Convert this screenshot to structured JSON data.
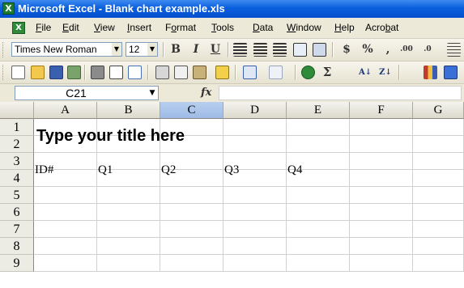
{
  "window": {
    "title": "Microsoft Excel - Blank chart example.xls"
  },
  "menu": [
    "File",
    "Edit",
    "View",
    "Insert",
    "Format",
    "Tools",
    "Data",
    "Window",
    "Help",
    "Acrobat"
  ],
  "menu_mnemonic": [
    "F",
    "E",
    "V",
    "I",
    "o",
    "T",
    "D",
    "W",
    "H",
    "b"
  ],
  "toolbar": {
    "font_name": "Times New Roman",
    "font_size": "12",
    "bold_label": "B",
    "italic_label": "I",
    "underline_label": "U",
    "currency_label": "$",
    "percent_label": "%",
    "comma_label": ",",
    "sum_label": "Σ",
    "increase_decimal_label": ".00",
    "decrease_decimal_label": ".0",
    "sort_az_label": "A↓",
    "sort_za_label": "Z↓"
  },
  "formula_bar": {
    "name_box": "C21",
    "fx_label": "fx",
    "formula": ""
  },
  "sheet": {
    "columns": [
      "A",
      "B",
      "C",
      "D",
      "E",
      "F",
      "G"
    ],
    "selected_column": "C",
    "rows": [
      "1",
      "2",
      "3",
      "4",
      "5",
      "6",
      "7",
      "8",
      "9"
    ],
    "title_cell": "Type your title here",
    "row3": [
      "ID#",
      "Q1",
      "Q2",
      "Q3",
      "Q4"
    ]
  },
  "colors": {
    "titlebar": "#0a5fde",
    "selected_header": "#9ebae6",
    "excel_green": "#1e7a2e"
  }
}
